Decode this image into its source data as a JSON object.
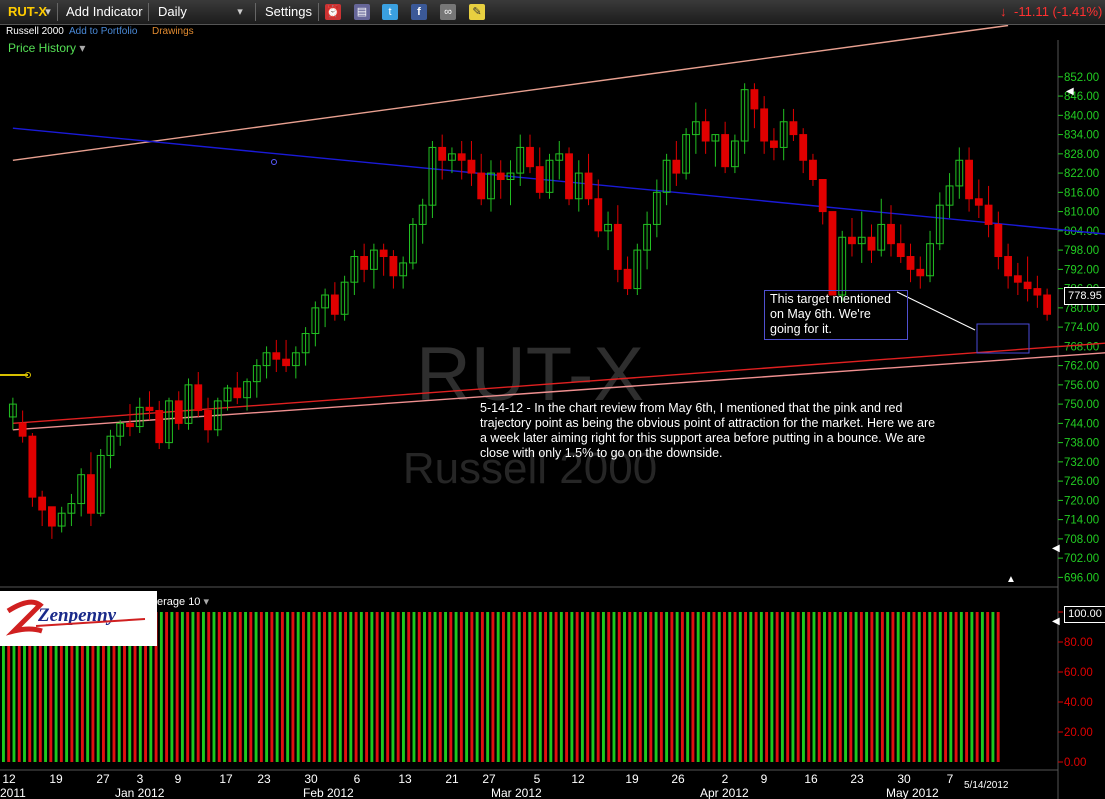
{
  "toolbar": {
    "symbol": "RUT-X",
    "add_indicator": "Add Indicator",
    "period": "Daily",
    "settings": "Settings",
    "change": "-11.11 (-1.41%)",
    "change_color": "#ff3030"
  },
  "subbar": {
    "name": "Russell 2000",
    "add_to_portfolio": "Add to Portfolio",
    "drawings": "Drawings",
    "price_history": "Price History"
  },
  "watermark": {
    "symbol": "RUT-X",
    "name": "Russell 2000"
  },
  "indicator": {
    "label": "erage 10"
  },
  "logo": {
    "text": "Zenpenny"
  },
  "annotations": {
    "target_note": [
      "This target mentioned",
      "on May 6th. We're",
      "going for it."
    ],
    "commentary": [
      "5-14-12 - In the chart review from May 6th, I mentioned that the pink and red",
      "trajectory point as being the obvious point of attraction for the market. Here we are",
      "a week later aiming right for this support area before putting in a bounce. We are",
      "close with only 1.5% to go on the downside."
    ]
  },
  "price_box": "778.95",
  "volume_box": "100.00",
  "date_stamp": "5/14/2012",
  "chart_data": {
    "type": "candlestick",
    "title": "RUT-X",
    "ylim": [
      693,
      856
    ],
    "y_ticks": [
      852,
      846,
      840,
      834,
      828,
      822,
      816,
      810,
      804,
      798,
      792,
      786,
      780,
      774,
      768,
      762,
      756,
      750,
      744,
      738,
      732,
      726,
      720,
      714,
      708,
      702,
      696
    ],
    "y_tick_labels": [
      "852.00",
      "846.00",
      "840.00",
      "834.00",
      "828.00",
      "822.00",
      "816.00",
      "810.00",
      "804.00",
      "798.00",
      "792.00",
      "786.00",
      "780.00",
      "774.00",
      "768.00",
      "762.00",
      "756.00",
      "750.00",
      "744.00",
      "738.00",
      "732.00",
      "726.00",
      "720.00",
      "714.00",
      "708.00",
      "702.00",
      "696.00"
    ],
    "x_tick_labels": [
      "12",
      "19",
      "27",
      "3",
      "9",
      "17",
      "23",
      "30",
      "6",
      "13",
      "21",
      "27",
      "5",
      "12",
      "19",
      "26",
      "2",
      "9",
      "16",
      "23",
      "30",
      "7"
    ],
    "month_labels": [
      "2011",
      "Jan 2012",
      "Feb 2012",
      "Mar 2012",
      "Apr 2012",
      "May 2012"
    ],
    "candles": [
      [
        746,
        752,
        742,
        750
      ],
      [
        744,
        748,
        738,
        740
      ],
      [
        740,
        741,
        718,
        721
      ],
      [
        721,
        723,
        712,
        717
      ],
      [
        718,
        718,
        708,
        712
      ],
      [
        712,
        718,
        710,
        716
      ],
      [
        716,
        722,
        712,
        719
      ],
      [
        719,
        730,
        715,
        728
      ],
      [
        728,
        735,
        712,
        716
      ],
      [
        716,
        736,
        715,
        734
      ],
      [
        734,
        742,
        730,
        740
      ],
      [
        740,
        745,
        737,
        744
      ],
      [
        744,
        750,
        740,
        743
      ],
      [
        743,
        752,
        741,
        749
      ],
      [
        749,
        754,
        745,
        748
      ],
      [
        748,
        751,
        736,
        738
      ],
      [
        738,
        752,
        736,
        751
      ],
      [
        751,
        754,
        742,
        744
      ],
      [
        744,
        758,
        742,
        756
      ],
      [
        756,
        760,
        746,
        748
      ],
      [
        748,
        752,
        738,
        742
      ],
      [
        742,
        752,
        740,
        751
      ],
      [
        751,
        756,
        748,
        755
      ],
      [
        755,
        760,
        750,
        752
      ],
      [
        752,
        758,
        748,
        757
      ],
      [
        757,
        764,
        752,
        762
      ],
      [
        762,
        768,
        758,
        766
      ],
      [
        766,
        770,
        760,
        764
      ],
      [
        764,
        770,
        760,
        762
      ],
      [
        762,
        768,
        758,
        766
      ],
      [
        766,
        774,
        762,
        772
      ],
      [
        772,
        782,
        768,
        780
      ],
      [
        780,
        786,
        774,
        784
      ],
      [
        784,
        788,
        776,
        778
      ],
      [
        778,
        790,
        776,
        788
      ],
      [
        788,
        798,
        784,
        796
      ],
      [
        796,
        800,
        788,
        792
      ],
      [
        792,
        800,
        786,
        798
      ],
      [
        798,
        800,
        790,
        796
      ],
      [
        796,
        798,
        786,
        790
      ],
      [
        790,
        796,
        786,
        794
      ],
      [
        794,
        808,
        792,
        806
      ],
      [
        806,
        814,
        800,
        812
      ],
      [
        812,
        832,
        808,
        830
      ],
      [
        830,
        834,
        820,
        826
      ],
      [
        826,
        830,
        822,
        828
      ],
      [
        828,
        832,
        820,
        826
      ],
      [
        826,
        832,
        818,
        822
      ],
      [
        822,
        828,
        812,
        814
      ],
      [
        814,
        826,
        810,
        822
      ],
      [
        822,
        826,
        814,
        820
      ],
      [
        820,
        826,
        812,
        822
      ],
      [
        822,
        834,
        818,
        830
      ],
      [
        830,
        834,
        822,
        824
      ],
      [
        824,
        830,
        814,
        816
      ],
      [
        816,
        828,
        814,
        826
      ],
      [
        826,
        832,
        820,
        828
      ],
      [
        828,
        830,
        812,
        814
      ],
      [
        814,
        826,
        810,
        822
      ],
      [
        822,
        828,
        812,
        814
      ],
      [
        814,
        820,
        802,
        804
      ],
      [
        804,
        810,
        798,
        806
      ],
      [
        806,
        812,
        788,
        792
      ],
      [
        792,
        796,
        784,
        786
      ],
      [
        786,
        800,
        784,
        798
      ],
      [
        798,
        810,
        792,
        806
      ],
      [
        806,
        820,
        802,
        816
      ],
      [
        816,
        828,
        812,
        826
      ],
      [
        826,
        832,
        818,
        822
      ],
      [
        822,
        836,
        820,
        834
      ],
      [
        834,
        844,
        828,
        838
      ],
      [
        838,
        842,
        828,
        832
      ],
      [
        832,
        834,
        824,
        834
      ],
      [
        834,
        838,
        822,
        824
      ],
      [
        824,
        834,
        822,
        832
      ],
      [
        832,
        850,
        828,
        848
      ],
      [
        848,
        850,
        836,
        842
      ],
      [
        842,
        846,
        828,
        832
      ],
      [
        832,
        836,
        826,
        830
      ],
      [
        830,
        842,
        826,
        838
      ],
      [
        838,
        842,
        832,
        834
      ],
      [
        834,
        836,
        822,
        826
      ],
      [
        826,
        828,
        818,
        820
      ],
      [
        820,
        816,
        806,
        810
      ],
      [
        810,
        808,
        786,
        784
      ],
      [
        784,
        804,
        782,
        802
      ],
      [
        802,
        808,
        796,
        800
      ],
      [
        800,
        810,
        794,
        802
      ],
      [
        802,
        806,
        794,
        798
      ],
      [
        798,
        814,
        796,
        806
      ],
      [
        806,
        812,
        796,
        800
      ],
      [
        800,
        806,
        794,
        796
      ],
      [
        796,
        800,
        788,
        792
      ],
      [
        792,
        796,
        786,
        790
      ],
      [
        790,
        804,
        788,
        800
      ],
      [
        800,
        816,
        798,
        812
      ],
      [
        812,
        822,
        808,
        818
      ],
      [
        818,
        830,
        814,
        826
      ],
      [
        826,
        830,
        810,
        814
      ],
      [
        814,
        820,
        808,
        812
      ],
      [
        812,
        818,
        802,
        806
      ],
      [
        806,
        810,
        792,
        796
      ],
      [
        796,
        800,
        786,
        790
      ],
      [
        790,
        794,
        784,
        788
      ],
      [
        788,
        796,
        782,
        786
      ],
      [
        786,
        790,
        780,
        784
      ],
      [
        784,
        786,
        776,
        778
      ]
    ],
    "trendlines": [
      {
        "name": "pink-upper",
        "color": "#e8a090",
        "points": [
          [
            0,
            826
          ],
          [
            102,
            868
          ]
        ]
      },
      {
        "name": "blue",
        "color": "#1a1ad8",
        "points": [
          [
            0,
            836
          ],
          [
            112,
            803
          ]
        ]
      },
      {
        "name": "red",
        "color": "#e02020",
        "points": [
          [
            0,
            744
          ],
          [
            112,
            769
          ]
        ]
      },
      {
        "name": "pink-lower",
        "color": "#f09090",
        "points": [
          [
            0,
            742
          ],
          [
            112,
            766
          ]
        ]
      }
    ],
    "volume_ylim": [
      0,
      100
    ],
    "volume_tick_labels": [
      "100.00",
      "80.00",
      "60.00",
      "40.00",
      "20.00",
      "0.00"
    ],
    "volume_ticks": [
      100,
      80,
      60,
      40,
      20,
      0
    ],
    "colors": {
      "up": "#22c022",
      "down": "#e00000",
      "axis": "#22cc22"
    }
  }
}
